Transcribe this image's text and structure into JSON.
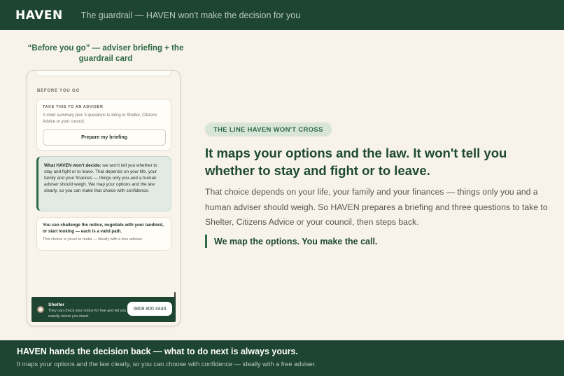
{
  "header": {
    "brand": "HAVEN",
    "tagline": "The guardrail — HAVEN won't make the decision for you"
  },
  "caption": "“Before you go” — adviser briefing + the guardrail card",
  "phone": {
    "section_label": "BEFORE YOU GO",
    "adviser_card": {
      "label": "TAKE THIS TO AN ADVISER",
      "description": "A short summary plus 3 questions to bring to Shelter, Citizens Advice or your council.",
      "button_label": "Prepare my briefing"
    },
    "guardrail_card": {
      "lead": "What HAVEN won't decide:",
      "text": " we won't tell you whether to stay and fight or to leave. That depends on your life, your family and your finances — things only you and a human adviser should weigh. We map your options and the law clearly, so you can make that choice with confidence."
    },
    "choice_card": {
      "bold": "You can challenge the notice, negotiate with your landlord, or start looking — each is a valid path.",
      "small": "This choice is yours to make — ideally with a free adviser."
    },
    "shelter": {
      "name": "Shelter",
      "description": "They can check your notice for free and tell you exactly where you stand.",
      "phone": "0808 800 4444"
    }
  },
  "main": {
    "pill": "THE LINE HAVEN WON'T CROSS",
    "headline": "It maps your options and the law. It won't tell you whether to stay and fight or to leave.",
    "body": "That choice depends on your life, your family and your finances — things only you and a human adviser should weigh. So HAVEN prepares a briefing and three questions to take to Shelter, Citizens Advice or your council, then steps back.",
    "quote": "We map the options. You make the call."
  },
  "footer": {
    "title": "HAVEN hands the decision back — what to do next is always yours.",
    "subtitle": "It maps your options and the law clearly, so you can choose with confidence — ideally with a free adviser."
  },
  "colors": {
    "brand_green": "#1e4432",
    "accent_green": "#2f6a47",
    "background": "#f7f2ea"
  }
}
